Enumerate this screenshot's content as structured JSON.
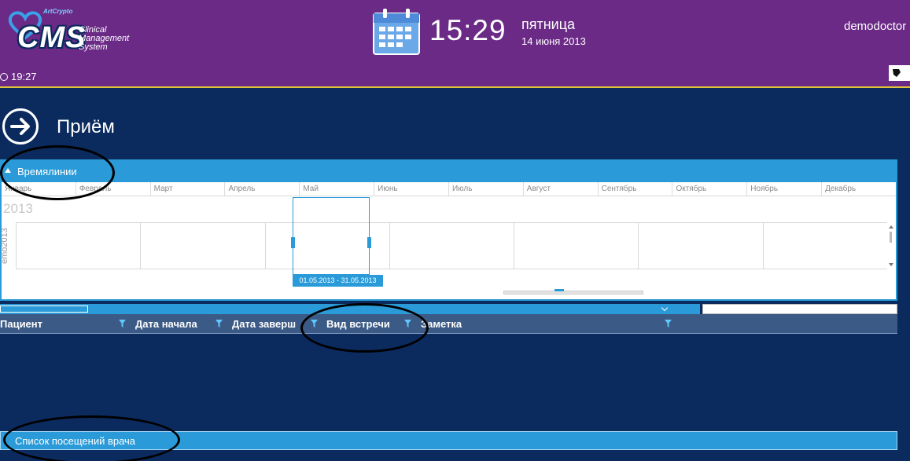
{
  "header": {
    "logo": {
      "brand": "ArtCrypto",
      "name": "CMS",
      "subtitle_lines": [
        "Clinical",
        "Management",
        "System"
      ]
    },
    "small_time": "19:27",
    "time": "15:29",
    "weekday": "пятница",
    "date": "14 июня 2013",
    "user": "demodoctor"
  },
  "page": {
    "title": "Приём"
  },
  "timeline": {
    "title": "Времялинии",
    "months": [
      "Январь",
      "Февраль",
      "Март",
      "Апрель",
      "Май",
      "Июнь",
      "Июль",
      "Август",
      "Сентябрь",
      "Октябрь",
      "Ноябрь",
      "Декабрь"
    ],
    "year": "2013",
    "lane_label": "emo2013",
    "selected_month": "Май",
    "selected_range": "01.05.2013 - 31.05.2013"
  },
  "grid": {
    "columns": [
      "Пациент",
      "Дата начала",
      "Дата заверш",
      "Вид встречи",
      "Заметка"
    ]
  },
  "footer": {
    "visits_title": "Список посещений врача"
  },
  "colors": {
    "header_bg": "#6a2a86",
    "page_bg": "#0b2a5e",
    "accent": "#2a9bd8"
  }
}
